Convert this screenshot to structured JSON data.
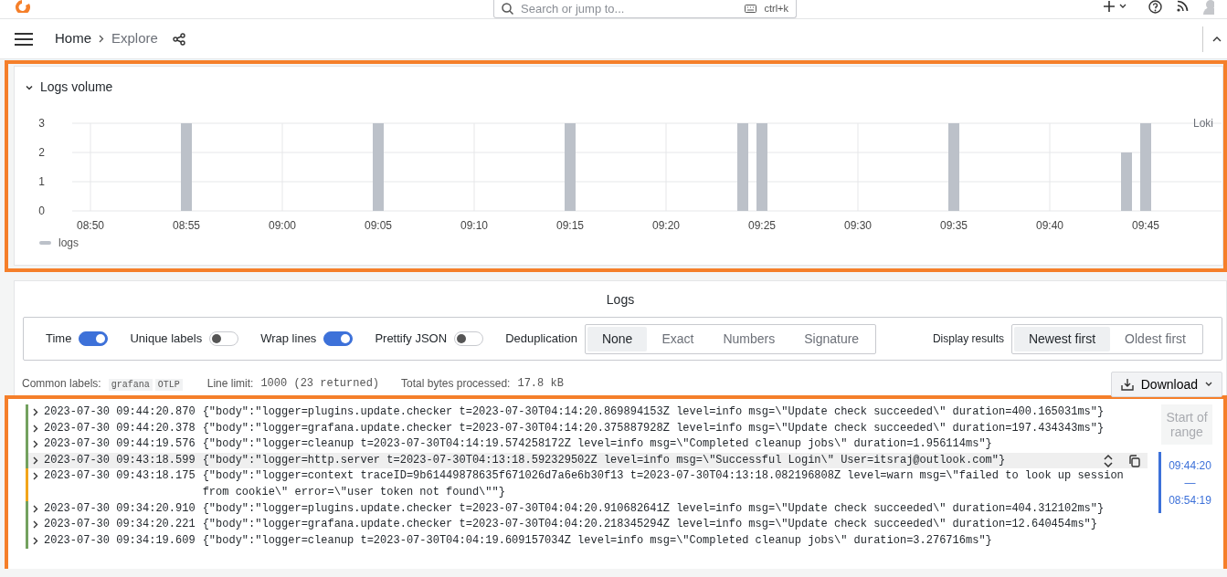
{
  "top_bar": {
    "search": {
      "placeholder": "Search or jump to...",
      "shortcut": "ctrl+k"
    }
  },
  "breadcrumbs": [
    {
      "label": "Home"
    },
    {
      "label": "Explore"
    }
  ],
  "logs_volume": {
    "title": "Logs volume",
    "expanded": true,
    "datasource": "Loki",
    "chart_data": {
      "type": "bar",
      "grid": true,
      "categories": [
        "08:50",
        null,
        null,
        null,
        null,
        "08:55",
        null,
        null,
        null,
        null,
        "09:00",
        null,
        null,
        null,
        null,
        "09:05",
        null,
        null,
        null,
        null,
        "09:10",
        null,
        null,
        null,
        null,
        "09:15",
        null,
        null,
        null,
        null,
        "09:20",
        null,
        null,
        null,
        null,
        "09:25",
        null,
        null,
        null,
        null,
        "09:30",
        null,
        null,
        null,
        null,
        "09:35",
        null,
        null,
        null,
        null,
        "09:40",
        null,
        null,
        null,
        null,
        "09:45"
      ],
      "series": [
        {
          "name": "logs",
          "color": "#bcc1c9",
          "values": [
            null,
            null,
            null,
            null,
            null,
            3,
            null,
            null,
            null,
            null,
            null,
            null,
            null,
            null,
            null,
            3,
            null,
            null,
            null,
            null,
            null,
            null,
            null,
            null,
            null,
            3,
            null,
            null,
            null,
            null,
            null,
            null,
            null,
            null,
            3,
            3,
            null,
            null,
            null,
            null,
            null,
            null,
            null,
            null,
            null,
            3,
            null,
            null,
            null,
            null,
            null,
            null,
            null,
            null,
            2,
            3
          ]
        }
      ],
      "ylim": [
        0,
        3
      ],
      "yticks": [
        0,
        1,
        2,
        3
      ]
    }
  },
  "logs": {
    "title": "Logs",
    "options": [
      {
        "label": "Time",
        "on": true
      },
      {
        "label": "Unique labels",
        "on": false
      },
      {
        "label": "Wrap lines",
        "on": true
      },
      {
        "label": "Prettify JSON",
        "on": false
      }
    ],
    "deduplication": {
      "label": "Deduplication",
      "options": [
        {
          "label": "None",
          "selected": true
        },
        {
          "label": "Exact",
          "selected": false
        },
        {
          "label": "Numbers",
          "selected": false
        },
        {
          "label": "Signature",
          "selected": false
        }
      ]
    },
    "display_results": {
      "label": "Display results",
      "options": [
        {
          "label": "Newest first",
          "selected": true
        },
        {
          "label": "Oldest first",
          "selected": false
        }
      ]
    },
    "common_labels": {
      "label": "Common labels:",
      "tags": [
        "grafana",
        "OTLP"
      ]
    },
    "line_limit": {
      "label": "Line limit:",
      "value": "1000 (23 returned)"
    },
    "bytes_processed": {
      "label": "Total bytes processed:",
      "value": "17.8 kB"
    },
    "download": "Download",
    "rows": [
      {
        "time": "2023-07-30 09:44:20.870",
        "body": "{\"body\":\"logger=plugins.update.checker t=2023-07-30T04:14:20.869894153Z level=info msg=\\\"Update check succeeded\\\" duration=400.165031ms\"}",
        "color": "#73a15f",
        "hovered": false
      },
      {
        "time": "2023-07-30 09:44:20.378",
        "body": "{\"body\":\"logger=grafana.update.checker t=2023-07-30T04:14:20.375887928Z level=info msg=\\\"Update check succeeded\\\" duration=197.434343ms\"}",
        "color": "#73a15f",
        "hovered": false
      },
      {
        "time": "2023-07-30 09:44:19.576",
        "body": "{\"body\":\"logger=cleanup t=2023-07-30T04:14:19.574258172Z level=info msg=\\\"Completed cleanup jobs\\\" duration=1.956114ms\"}",
        "color": "#73a15f",
        "hovered": false
      },
      {
        "time": "2023-07-30 09:43:18.599",
        "body": "{\"body\":\"logger=http.server t=2023-07-30T04:13:18.592329502Z level=info msg=\\\"Successful Login\\\" User=itsraj@outlook.com\"}",
        "color": "#73a15f",
        "hovered": true
      },
      {
        "time": "2023-07-30 09:43:18.175",
        "body": "{\"body\":\"logger=context traceID=9b61449878635f671026d7a6e6b30f13 t=2023-07-30T04:13:18.082196808Z level=warn msg=\\\"failed to look up session from cookie\\\" error=\\\"user token not found\\\"\"}",
        "color": "#f2a51a",
        "hovered": false
      },
      {
        "time": "2023-07-30 09:34:20.910",
        "body": "{\"body\":\"logger=plugins.update.checker t=2023-07-30T04:04:20.910682641Z level=info msg=\\\"Update check succeeded\\\" duration=404.312102ms\"}",
        "color": "#73a15f",
        "hovered": false
      },
      {
        "time": "2023-07-30 09:34:20.221",
        "body": "{\"body\":\"logger=grafana.update.checker t=2023-07-30T04:04:20.218345294Z level=info msg=\\\"Update check succeeded\\\" duration=12.640454ms\"}",
        "color": "#73a15f",
        "hovered": false
      },
      {
        "time": "2023-07-30 09:34:19.609",
        "body": "{\"body\":\"logger=cleanup t=2023-07-30T04:04:19.609157034Z level=info msg=\\\"Completed cleanup jobs\\\" duration=3.276716ms\"}",
        "color": "#73a15f",
        "hovered": false
      }
    ],
    "range": {
      "start_label": "Start of range",
      "disabled": true,
      "from": "09:44:20",
      "separator": "—",
      "to": "08:54:19"
    }
  }
}
